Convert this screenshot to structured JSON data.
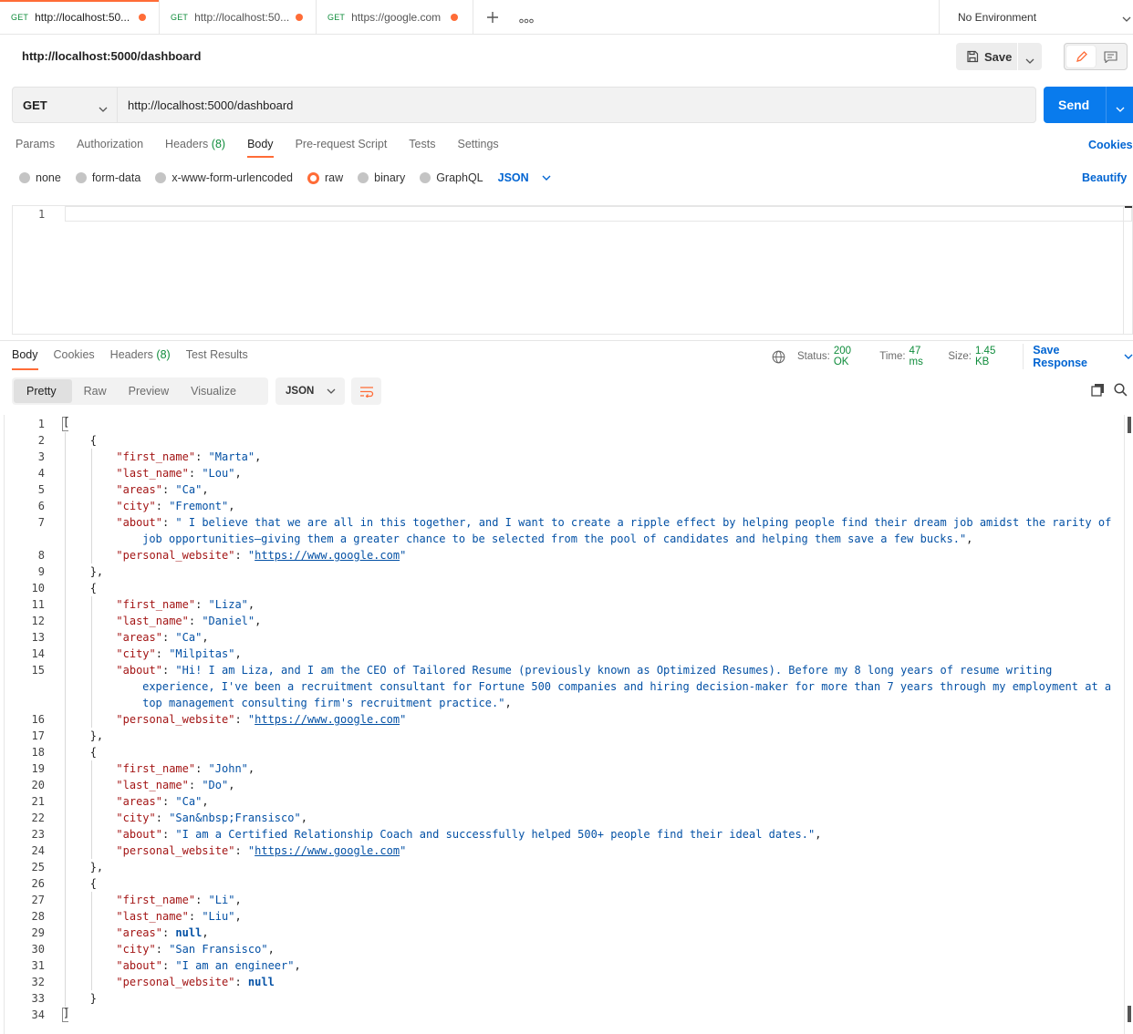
{
  "tabs": [
    {
      "method": "GET",
      "url": "http://localhost:50...",
      "active": true
    },
    {
      "method": "GET",
      "url": "http://localhost:50...",
      "active": false
    },
    {
      "method": "GET",
      "url": "https://google.com",
      "active": false
    }
  ],
  "environment": {
    "label": "No Environment"
  },
  "request": {
    "name": "http://localhost:5000/dashboard",
    "save_label": "Save",
    "method": "GET",
    "url": "http://localhost:5000/dashboard",
    "send_label": "Send"
  },
  "request_tabs": {
    "params": "Params",
    "authorization": "Authorization",
    "headers": "Headers",
    "headers_count": "(8)",
    "body": "Body",
    "prerequest": "Pre-request Script",
    "tests": "Tests",
    "settings": "Settings",
    "cookies": "Cookies"
  },
  "body_types": {
    "none": "none",
    "form_data": "form-data",
    "urlencoded": "x-www-form-urlencoded",
    "raw": "raw",
    "binary": "binary",
    "graphql": "GraphQL",
    "format": "JSON",
    "beautify": "Beautify"
  },
  "request_editor": {
    "line": "1"
  },
  "response_tabs": {
    "body": "Body",
    "cookies": "Cookies",
    "headers": "Headers",
    "headers_count": "(8)",
    "test_results": "Test Results"
  },
  "response_status": {
    "status_label": "Status:",
    "status": "200 OK",
    "time_label": "Time:",
    "time": "47 ms",
    "size_label": "Size:",
    "size": "1.45 KB",
    "save_response": "Save Response"
  },
  "response_view": {
    "pretty": "Pretty",
    "raw": "Raw",
    "preview": "Preview",
    "visualize": "Visualize",
    "language": "JSON"
  },
  "response_body": [
    {
      "first_name": "Marta",
      "last_name": "Lou",
      "areas": "Ca",
      "city": "Fremont",
      "about_lines": [
        "\" I believe that we are all in this together, and I want to create a ripple effect by helping people find their dream job amidst the rarity of",
        "job opportunities—giving them a greater chance to be selected from the pool of candidates and helping them save a few bucks.\""
      ],
      "personal_website": "https://www.google.com"
    },
    {
      "first_name": "Liza",
      "last_name": "Daniel",
      "areas": "Ca",
      "city": "Milpitas",
      "about_lines": [
        "\"Hi! I am Liza, and I am the CEO of Tailored Resume (previously known as Optimized Resumes). Before my 8 long years of resume writing",
        "experience, I've been a recruitment consultant for Fortune 500 companies and hiring decision-maker for more than 7 years through my employment at a",
        "top management consulting firm's recruitment practice.\""
      ],
      "personal_website": "https://www.google.com"
    },
    {
      "first_name": "John",
      "last_name": "Do",
      "areas": "Ca",
      "city": "San&nbsp;Fransisco",
      "about_lines": [
        "\"I am a Certified Relationship Coach and successfully helped 500+ people find their ideal dates.\""
      ],
      "personal_website": "https://www.google.com"
    },
    {
      "first_name": "Li",
      "last_name": "Liu",
      "areas": null,
      "city": "San Fransisco",
      "about_lines": [
        "\"I am an engineer\""
      ],
      "personal_website": null
    }
  ],
  "colors": {
    "accent": "#ff6c37",
    "primary": "#097bed",
    "link": "#0265d2",
    "success": "#0f8c3b",
    "json_key": "#a31515",
    "json_string": "#0451a5"
  },
  "icons": [
    "plus-icon",
    "more-icon",
    "chevron-down-icon",
    "save-icon",
    "pencil-icon",
    "comment-icon",
    "globe-icon",
    "wrap-lines-icon",
    "copy-icon",
    "search-icon"
  ]
}
